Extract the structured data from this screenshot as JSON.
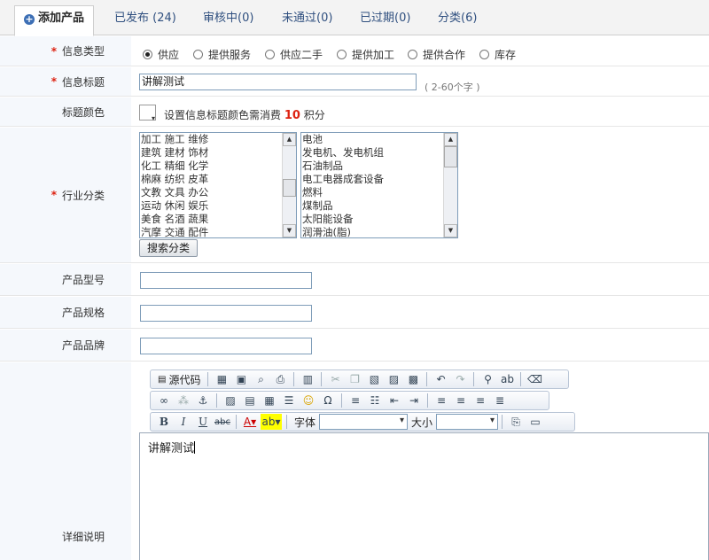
{
  "tabs": [
    {
      "label": "添加产品",
      "active": true
    },
    {
      "label": "已发布 (24)"
    },
    {
      "label": "审核中(0)"
    },
    {
      "label": "未通过(0)"
    },
    {
      "label": "已过期(0)"
    },
    {
      "label": "分类(6)"
    }
  ],
  "form": {
    "required_mark": "*",
    "info_type": {
      "label": "信息类型",
      "options": [
        "供应",
        "提供服务",
        "供应二手",
        "提供加工",
        "提供合作",
        "库存"
      ],
      "selected": "供应"
    },
    "info_title": {
      "label": "信息标题",
      "value": "讲解测试",
      "hint": "( 2-60个字 )"
    },
    "title_color": {
      "label": "标题颜色",
      "text_before": "设置信息标题颜色需消费",
      "credits": "10",
      "text_after": "积分"
    },
    "industry": {
      "label": "行业分类",
      "left_list": [
        "加工 施工 维修",
        "建筑 建材 饰材",
        "化工 精细 化学",
        "棉麻 纺织 皮革",
        "文教 文具 办公",
        "运动 休闲 娱乐",
        "美食 名酒 蔬果",
        "汽摩 交通 配件"
      ],
      "right_list": [
        "电池",
        "发电机、发电机组",
        "石油制品",
        "电工电器成套设备",
        "燃料",
        "煤制品",
        "太阳能设备",
        "润滑油(脂)"
      ],
      "search_button": "搜索分类"
    },
    "model": {
      "label": "产品型号",
      "value": ""
    },
    "spec": {
      "label": "产品规格",
      "value": ""
    },
    "brand": {
      "label": "产品品牌",
      "value": ""
    },
    "detail": {
      "label": "详细说明",
      "toolbar": {
        "source_label": "源代码",
        "font_label": "字体",
        "size_label": "大小"
      },
      "content": "讲解测试"
    }
  },
  "icons": {
    "add_tab": "plus-circle-icon",
    "source": "source-code-icon",
    "cut": "scissors-icon",
    "undo": "undo-icon",
    "redo": "redo-icon",
    "find": "binoculars-icon",
    "eraser": "eraser-icon",
    "smiley": "smiley-icon",
    "omega": "special-char-icon"
  },
  "colors": {
    "required": "#dd2211",
    "credit": "#dd2211",
    "label_bg": "#f5f8fc",
    "tab_text": "#2f4f7f"
  }
}
